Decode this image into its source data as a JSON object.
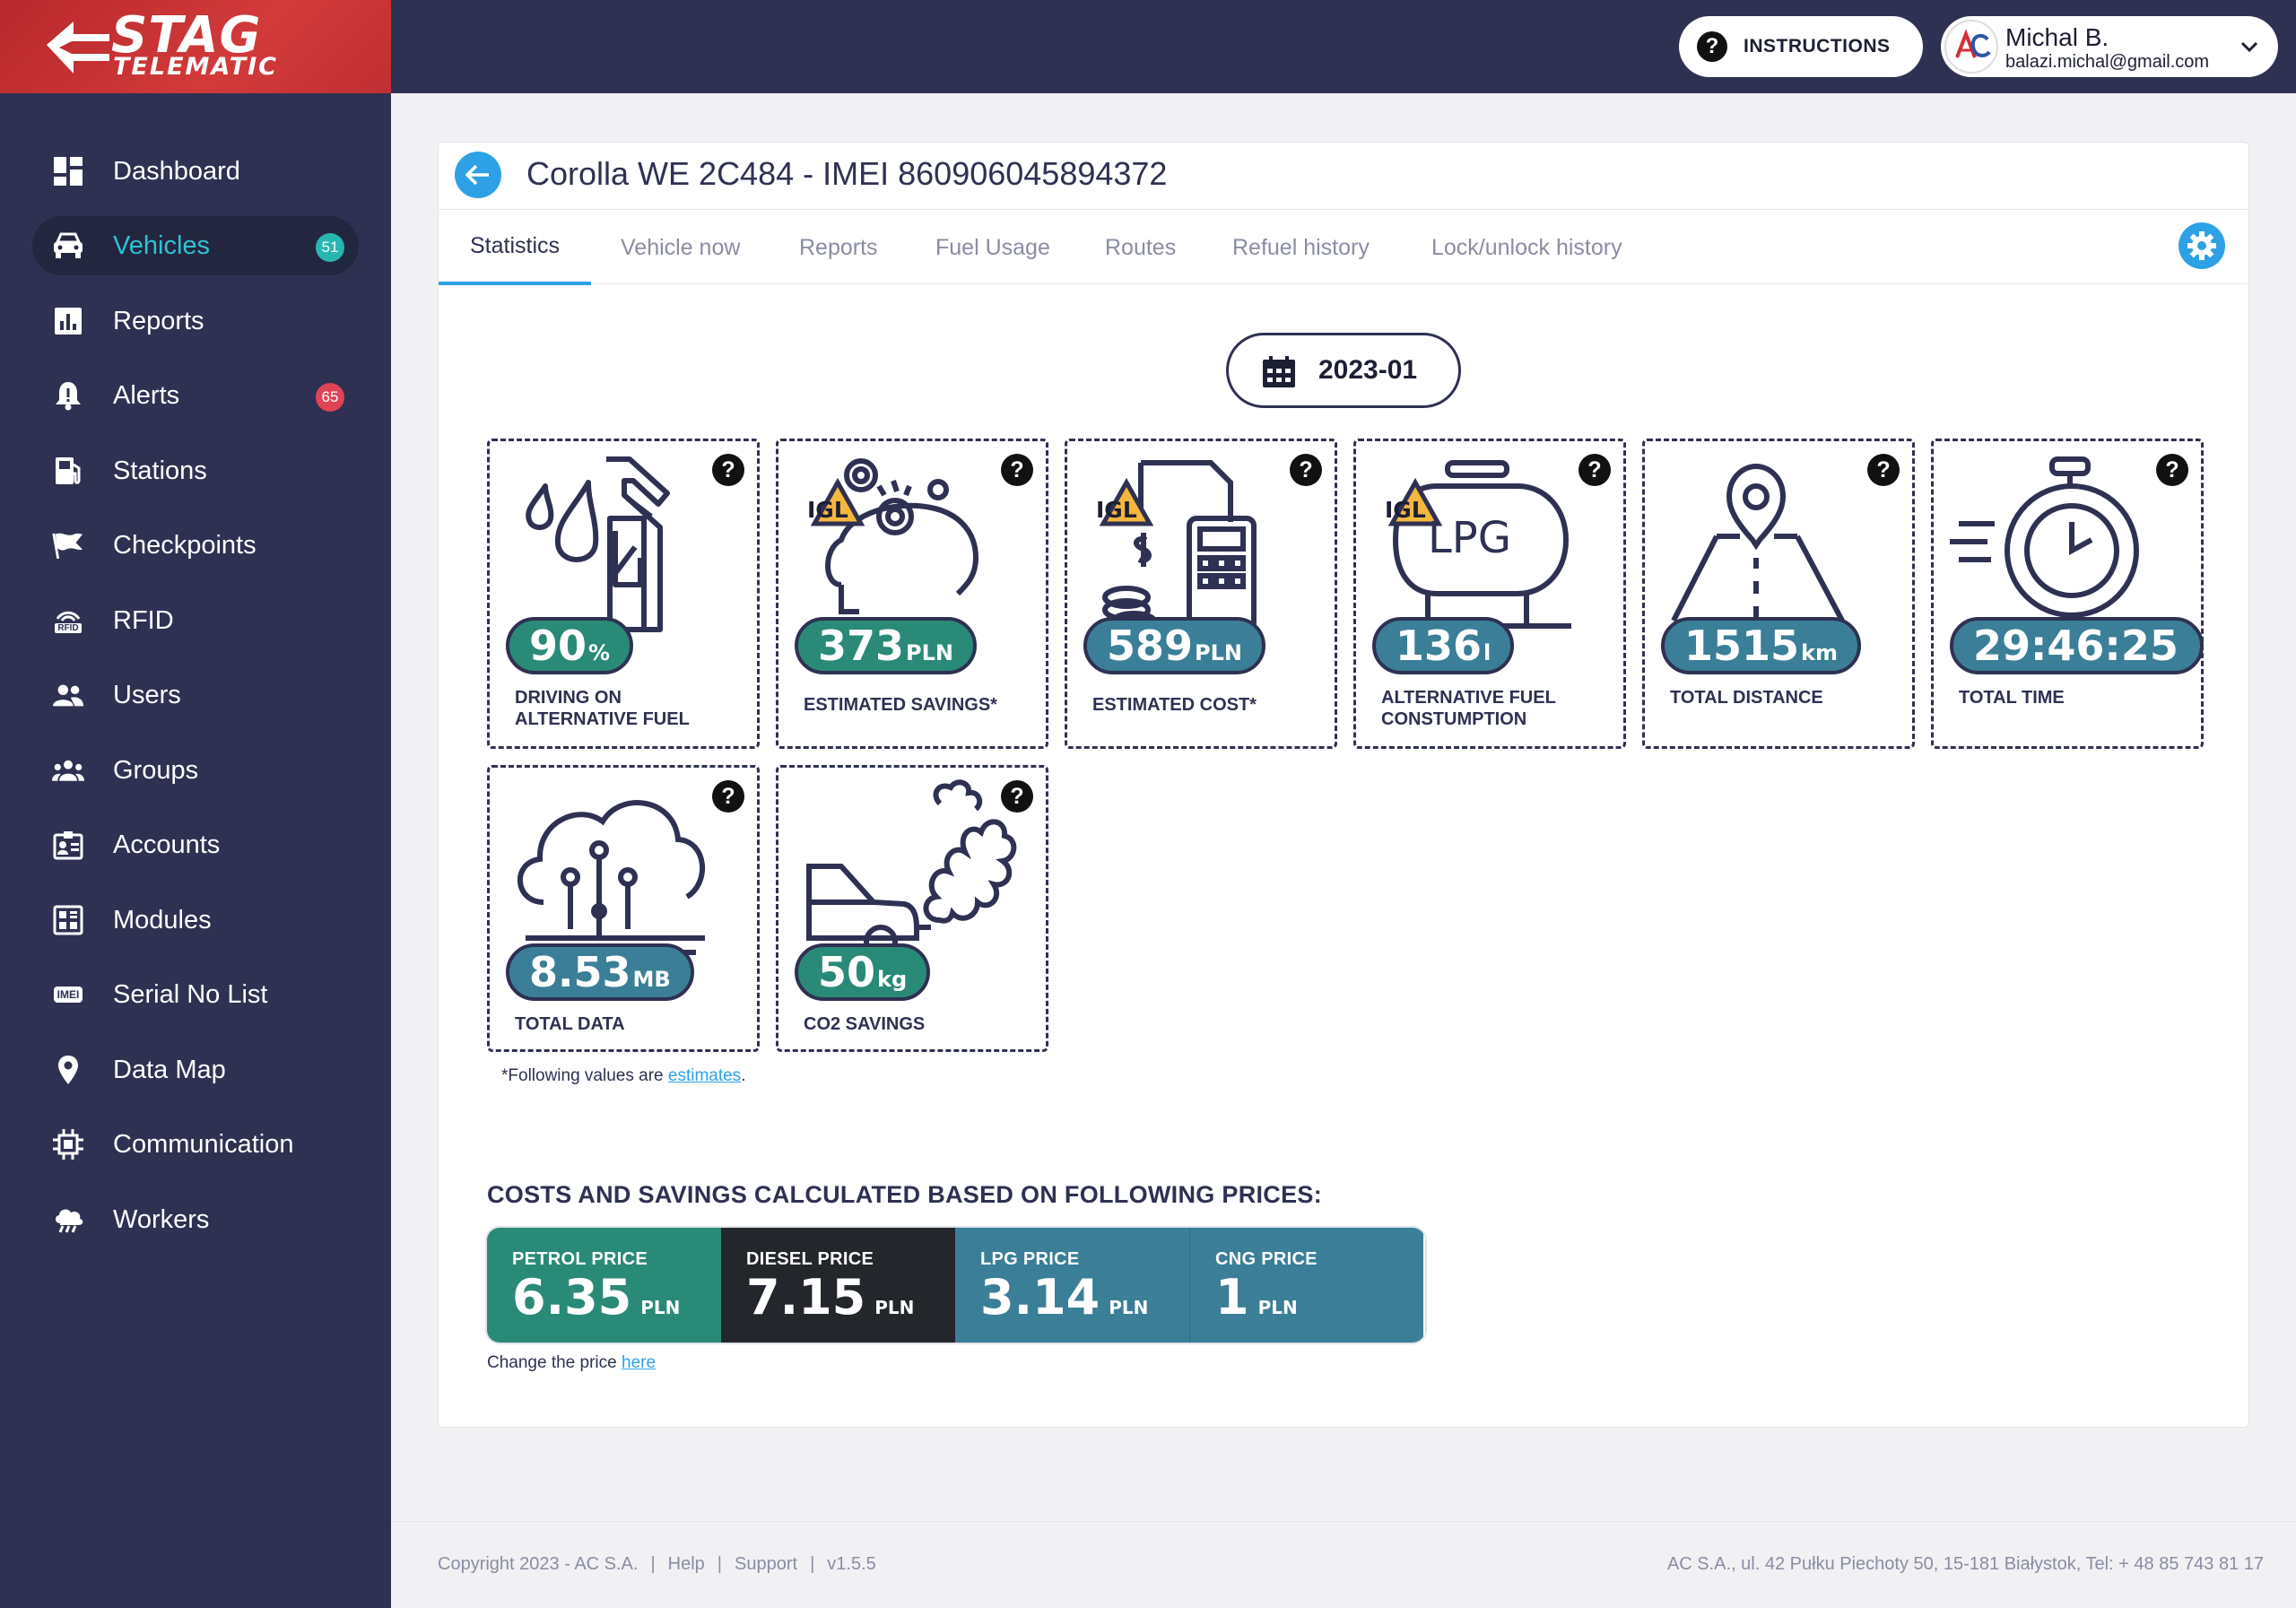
{
  "brand": {
    "name_main": "STAG",
    "name_sub": "TELEMATIC"
  },
  "colors": {
    "sidebar": "#2e3152",
    "accent": "#2ea1e6",
    "active_text": "#2ec2d6",
    "green": "#2a8a78",
    "teal": "#3a7f97",
    "dark": "#23262b",
    "badge_teal": "#27b7b0",
    "badge_red": "#e04356"
  },
  "sidebar": {
    "items": [
      {
        "label": "Dashboard",
        "icon": "dashboard-icon"
      },
      {
        "label": "Vehicles",
        "icon": "car-icon",
        "badge": "51",
        "active": true
      },
      {
        "label": "Reports",
        "icon": "bar-chart-icon"
      },
      {
        "label": "Alerts",
        "icon": "bell-alert-icon",
        "badge": "65"
      },
      {
        "label": "Stations",
        "icon": "fuel-station-icon"
      },
      {
        "label": "Checkpoints",
        "icon": "flag-icon"
      },
      {
        "label": "RFID",
        "icon": "rfid-icon"
      },
      {
        "label": "Users",
        "icon": "users-icon"
      },
      {
        "label": "Groups",
        "icon": "groups-icon"
      },
      {
        "label": "Accounts",
        "icon": "id-card-icon"
      },
      {
        "label": "Modules",
        "icon": "module-icon"
      },
      {
        "label": "Serial No List",
        "icon": "imei-icon"
      },
      {
        "label": "Data Map",
        "icon": "map-pin-icon"
      },
      {
        "label": "Communication",
        "icon": "chip-icon"
      },
      {
        "label": "Workers",
        "icon": "cloud-icon"
      }
    ],
    "imei_tag": "IMEI",
    "rfid_tag": "RFID"
  },
  "header": {
    "instructions_label": "INSTRUCTIONS",
    "user_name": "Michal B.",
    "user_email": "balazi.michal@gmail.com"
  },
  "vehicle": {
    "title": "Corolla WE 2C484 - IMEI 860906045894372"
  },
  "tabs": [
    "Statistics",
    "Vehicle now",
    "Reports",
    "Fuel Usage",
    "Routes",
    "Refuel history",
    "Lock/unlock history"
  ],
  "period": "2023-01",
  "tiles": [
    {
      "value": "90",
      "unit": "%",
      "label1": "DRIVING ON",
      "label2": "ALTERNATIVE FUEL",
      "icon": "fuel-nozzle-icon",
      "color": "green"
    },
    {
      "value": "373",
      "unit": "PLN",
      "label1": "ESTIMATED SAVINGS*",
      "label2": "",
      "icon": "piggy-bank-icon",
      "tag": "IGL",
      "color": "green"
    },
    {
      "value": "589",
      "unit": "PLN",
      "label1": "ESTIMATED COST*",
      "label2": "",
      "icon": "calculator-icon",
      "tag": "IGL",
      "color": "blue"
    },
    {
      "value": "136",
      "unit": "l",
      "label1": "ALTERNATIVE FUEL",
      "label2": "CONSTUMPTION",
      "icon": "lpg-tank-icon",
      "tag": "IGL",
      "tank": "LPG",
      "color": "blue"
    },
    {
      "value": "1515",
      "unit": "km",
      "label1": "TOTAL DISTANCE",
      "label2": "",
      "icon": "road-pin-icon",
      "color": "blue"
    },
    {
      "value": "29:46:25",
      "unit": "",
      "label1": "TOTAL TIME",
      "label2": "",
      "icon": "stopwatch-icon",
      "color": "blue"
    },
    {
      "value": "8.53",
      "unit": "MB",
      "label1": "TOTAL DATA",
      "label2": "",
      "icon": "cloud-circuit-icon",
      "color": "blue"
    },
    {
      "value": "50",
      "unit": "kg",
      "label1": "CO2 SAVINGS",
      "label2": "",
      "icon": "car-exhaust-icon",
      "color": "green"
    }
  ],
  "help_glyph": "?",
  "estimate_note": {
    "text": "*Following values are ",
    "link": "estimates",
    "end": "."
  },
  "prices": {
    "heading": "COSTS AND SAVINGS CALCULATED BASED ON FOLLOWING PRICES:",
    "items": [
      {
        "label": "PETROL PRICE",
        "value": "6.35",
        "unit": "PLN"
      },
      {
        "label": "DIESEL PRICE",
        "value": "7.15",
        "unit": "PLN"
      },
      {
        "label": "LPG PRICE",
        "value": "3.14",
        "unit": "PLN"
      },
      {
        "label": "CNG PRICE",
        "value": "1",
        "unit": "PLN"
      }
    ],
    "change_text": "Change the price ",
    "change_link": "here"
  },
  "footer": {
    "copyright": "Copyright 2023 - AC S.A.",
    "help": "Help",
    "support": "Support",
    "version": "v1.5.5",
    "address": "AC S.A., ul. 42 Pułku Piechoty 50, 15-181 Białystok, Tel: + 48 85 743 81 17"
  }
}
